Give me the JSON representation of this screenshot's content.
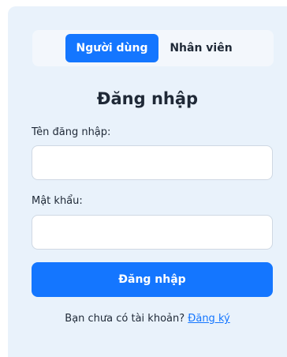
{
  "tabs": {
    "user_label": "Người dùng",
    "staff_label": "Nhân viên",
    "active": "user"
  },
  "form": {
    "title": "Đăng nhập",
    "username_label": "Tên đăng nhập:",
    "username_value": "",
    "password_label": "Mật khẩu:",
    "password_value": "",
    "submit_label": "Đăng nhập"
  },
  "footer": {
    "prompt_text": "Bạn chưa có tài khoản?",
    "register_link": "Đăng ký"
  },
  "colors": {
    "accent": "#1476ff",
    "card_background": "#e9f2fb",
    "text": "#1f2937"
  }
}
